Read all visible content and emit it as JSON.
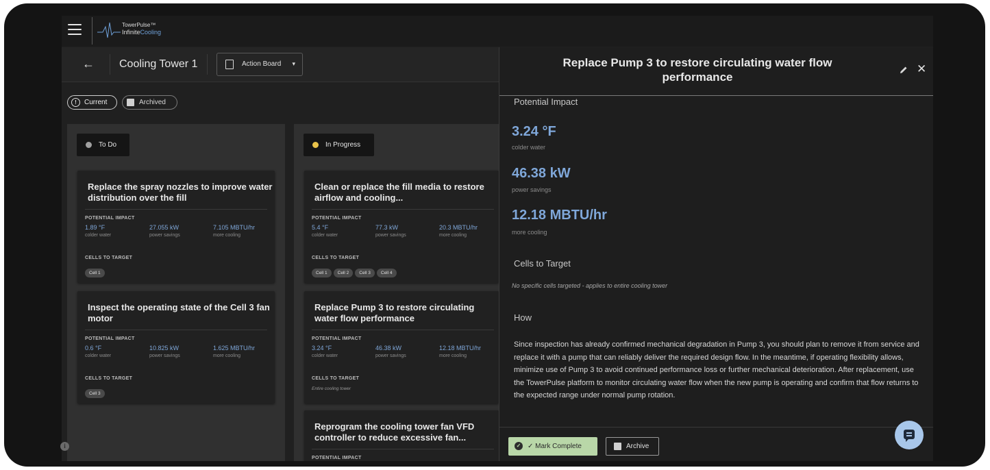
{
  "brand": {
    "name": "TowerPulse™",
    "product_prefix": "Infinite",
    "product_suffix": "Cooling"
  },
  "header": {
    "back_glyph": "←",
    "tower": "Cooling Tower 1",
    "board_label": "Action Board",
    "dropdown_caret": "▾"
  },
  "filters": {
    "current": "Current",
    "archived": "Archived"
  },
  "columns": [
    {
      "label": "To Do",
      "dot_color": "#a0a0a0",
      "cards": [
        {
          "title": "Replace the spray nozzles to improve water distribution over the fill",
          "impact_label": "POTENTIAL IMPACT",
          "metrics": [
            {
              "value": "1.89 °F",
              "label": "colder water"
            },
            {
              "value": "27.055 kW",
              "label": "power savings"
            },
            {
              "value": "7.105 MBTU/hr",
              "label": "more cooling"
            }
          ],
          "cells_label": "CELLS TO TARGET",
          "cells": [
            "Cell 1"
          ]
        },
        {
          "title": "Inspect the operating state of the Cell 3 fan motor",
          "impact_label": "POTENTIAL IMPACT",
          "metrics": [
            {
              "value": "0.6 °F",
              "label": "colder water"
            },
            {
              "value": "10.825 kW",
              "label": "power savings"
            },
            {
              "value": "1.625 MBTU/hr",
              "label": "more cooling"
            }
          ],
          "cells_label": "CELLS TO TARGET",
          "cells": [
            "Cell 3"
          ]
        }
      ]
    },
    {
      "label": "In Progress",
      "dot_color": "#e9c34a",
      "cards": [
        {
          "title": "Clean or replace the fill media to restore airflow and cooling...",
          "impact_label": "POTENTIAL IMPACT",
          "metrics": [
            {
              "value": "5.4 °F",
              "label": "colder water"
            },
            {
              "value": "77.3 kW",
              "label": "power savings"
            },
            {
              "value": "20.3 MBTU/hr",
              "label": "more cooling"
            }
          ],
          "cells_label": "CELLS TO TARGET",
          "cells": [
            "Cell 1",
            "Cell 2",
            "Cell 3",
            "Cell 4"
          ]
        },
        {
          "title": "Replace Pump 3 to restore circulating water flow performance",
          "impact_label": "POTENTIAL IMPACT",
          "metrics": [
            {
              "value": "3.24 °F",
              "label": "colder water"
            },
            {
              "value": "46.38 kW",
              "label": "power savings"
            },
            {
              "value": "12.18 MBTU/hr",
              "label": "more cooling"
            }
          ],
          "cells_label": "CELLS TO TARGET",
          "cells_note": "Entire cooling tower"
        },
        {
          "title": "Reprogram the cooling tower fan VFD controller to reduce excessive fan...",
          "impact_label": "POTENTIAL IMPACT"
        }
      ]
    }
  ],
  "detail": {
    "title": "Replace Pump 3 to restore circulating water flow performance",
    "close_glyph": "✕",
    "impact_heading": "Potential Impact",
    "impacts": [
      {
        "value": "3.24 °F",
        "label": "colder water"
      },
      {
        "value": "46.38 kW",
        "label": "power savings"
      },
      {
        "value": "12.18 MBTU/hr",
        "label": "more cooling"
      }
    ],
    "cells_heading": "Cells to Target",
    "cells_note": "No specific cells targeted - applies to entire cooling tower",
    "how_heading": "How",
    "how_text": "Since inspection has already confirmed mechanical degradation in Pump 3, you should plan to remove it from service and replace it with a pump that can reliably deliver the required design flow. In the meantime, if operating flexibility allows, minimize use of Pump 3 to avoid continued performance loss or further mechanical deterioration. After replacement, use the TowerPulse platform to monitor circulating water flow when the new pump is operating and confirm that flow returns to the expected range under normal pump rotation.",
    "mark_complete": "✓ Mark Complete",
    "archive": "Archive"
  },
  "info_glyph": "i",
  "colors": {
    "accent_blue": "#7fa7d9",
    "complete_green": "#b9d7a8",
    "progress_yellow": "#e9c34a"
  }
}
